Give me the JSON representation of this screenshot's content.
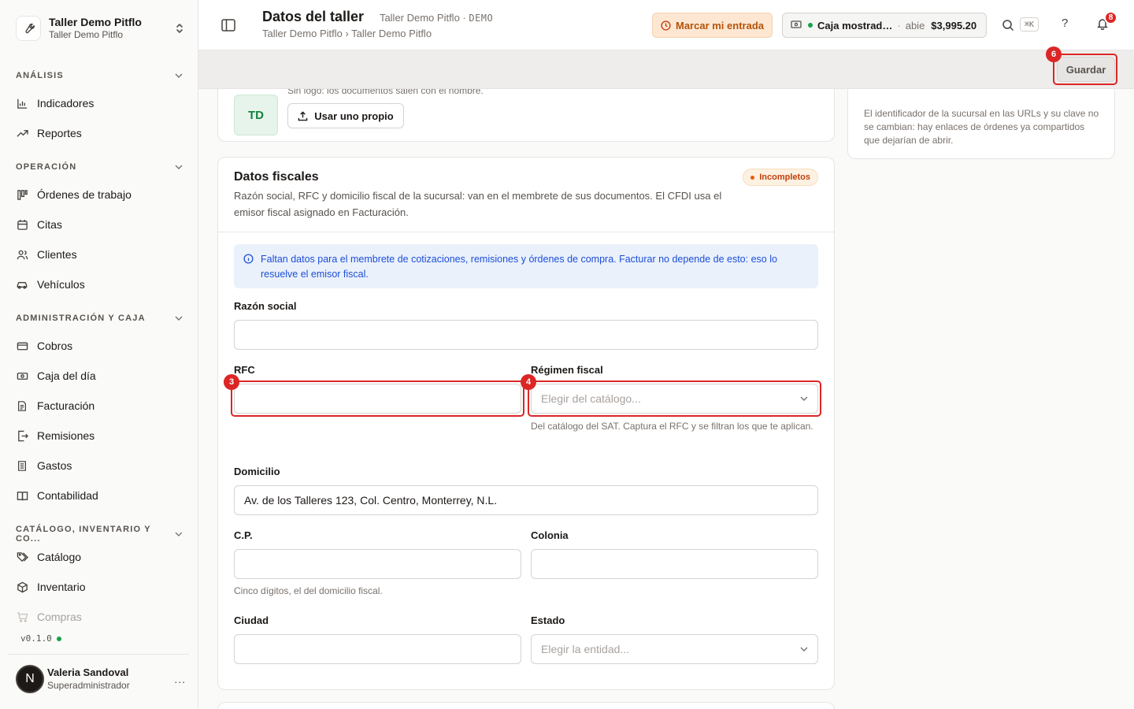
{
  "sidebar": {
    "org_name": "Taller Demo Pitflo",
    "org_sub": "Taller Demo Pitflo",
    "sections": [
      {
        "label": "ANÁLISIS"
      },
      {
        "label": "OPERACIÓN"
      },
      {
        "label": "ADMINISTRACIÓN Y CAJA"
      },
      {
        "label": "CATÁLOGO, INVENTARIO Y CO..."
      }
    ],
    "items": [
      {
        "label": "Indicadores",
        "icon": "bar-chart-icon"
      },
      {
        "label": "Reportes",
        "icon": "trending-up-icon"
      },
      {
        "label": "Órdenes de trabajo",
        "icon": "kanban-icon"
      },
      {
        "label": "Citas",
        "icon": "calendar-icon"
      },
      {
        "label": "Clientes",
        "icon": "users-icon"
      },
      {
        "label": "Vehículos",
        "icon": "car-icon"
      },
      {
        "label": "Cobros",
        "icon": "credit-card-icon"
      },
      {
        "label": "Caja del día",
        "icon": "cash-icon"
      },
      {
        "label": "Facturación",
        "icon": "file-text-icon"
      },
      {
        "label": "Remisiones",
        "icon": "file-export-icon"
      },
      {
        "label": "Gastos",
        "icon": "receipt-icon"
      },
      {
        "label": "Contabilidad",
        "icon": "book-icon"
      },
      {
        "label": "Catálogo",
        "icon": "tags-icon"
      },
      {
        "label": "Inventario",
        "icon": "package-icon"
      },
      {
        "label": "Compras",
        "icon": "cart-icon"
      }
    ],
    "version": "v0.1.0",
    "user": {
      "initial": "N",
      "name": "Valeria Sandoval",
      "role": "Superadministrador",
      "more": "..."
    }
  },
  "header": {
    "title": "Datos del taller",
    "subtitle": "Taller Demo Pitflo · ",
    "subtitle_tag": "DEMO",
    "breadcrumb": "Taller Demo Pitflo › Taller Demo Pitflo",
    "entrada_label": "Marcar mi entrada",
    "caja_name": "Caja mostrad…",
    "caja_state": "abie",
    "caja_amount": "$3,995.20",
    "kbd": "⌘K",
    "help": "?",
    "notifications": "8"
  },
  "savebar": {
    "guardar_label": "Guardar",
    "marker": "6"
  },
  "logo_card": {
    "initials": "TD",
    "hint": "Sin logo: los documentos salen con el nombre.",
    "button_label": "Usar uno propio"
  },
  "side_card": {
    "note": "El identificador de la sucursal en las URLs y su clave no se cambian: hay enlaces de órdenes ya compartidos que dejarían de abrir."
  },
  "fiscal": {
    "title": "Datos fiscales",
    "description": "Razón social, RFC y domicilio fiscal de la sucursal: van en el membrete de sus documentos. El CFDI usa el emisor fiscal asignado en Facturación.",
    "status": "Incompletos",
    "alert": "Faltan datos para el membrete de cotizaciones, remisiones y órdenes de compra. Facturar no depende de esto: eso lo resuelve el emisor fiscal.",
    "razon_label": "Razón social",
    "razon_value": "",
    "rfc_label": "RFC",
    "rfc_value": "",
    "rfc_marker": "3",
    "regimen_label": "Régimen fiscal",
    "regimen_placeholder": "Elegir del catálogo...",
    "regimen_marker": "4",
    "regimen_help": "Del catálogo del SAT. Captura el RFC y se filtran los que te aplican.",
    "domicilio_label": "Domicilio",
    "domicilio_value": "Av. de los Talleres 123, Col. Centro, Monterrey, N.L.",
    "cp_label": "C.P.",
    "cp_value": "",
    "cp_help": "Cinco dígitos, el del domicilio fiscal.",
    "colonia_label": "Colonia",
    "colonia_value": "",
    "ciudad_label": "Ciudad",
    "ciudad_value": "",
    "estado_label": "Estado",
    "estado_placeholder": "Elegir la entidad..."
  },
  "colors": {
    "accent_red": "#dc2626",
    "brand_green": "#16a34a",
    "warning": "#c2410c",
    "info": "#1d4ed8"
  }
}
